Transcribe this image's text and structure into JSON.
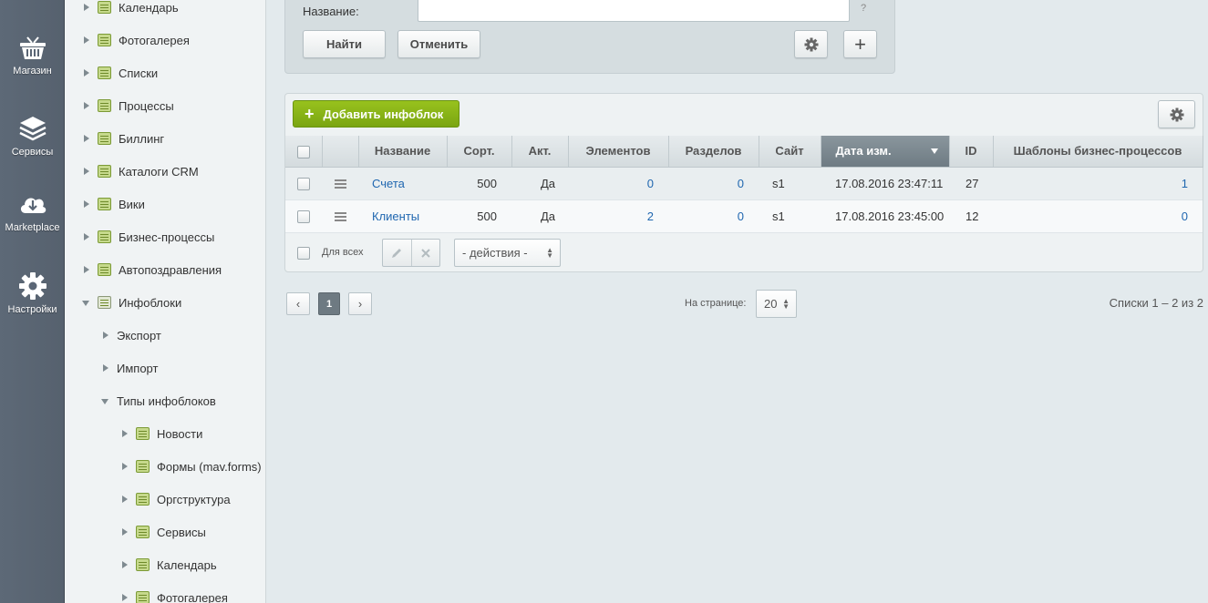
{
  "leftbar": {
    "items": [
      {
        "label": "Магазин",
        "icon": "basket-icon"
      },
      {
        "label": "Сервисы",
        "icon": "layers-icon"
      },
      {
        "label": "Marketplace",
        "icon": "cloud-download-icon"
      },
      {
        "label": "Настройки",
        "icon": "gear-icon"
      }
    ]
  },
  "tree": {
    "items": [
      {
        "label": "Календарь"
      },
      {
        "label": "Фотогалерея"
      },
      {
        "label": "Списки"
      },
      {
        "label": "Процессы"
      },
      {
        "label": "Биллинг"
      },
      {
        "label": "Каталоги CRM"
      },
      {
        "label": "Вики"
      },
      {
        "label": "Бизнес-процессы"
      },
      {
        "label": "Автопоздравления"
      },
      {
        "label": "Инфоблоки"
      },
      {
        "label": "Экспорт"
      },
      {
        "label": "Импорт"
      },
      {
        "label": "Типы инфоблоков"
      },
      {
        "label": "Новости"
      },
      {
        "label": "Формы (mav.forms)"
      },
      {
        "label": "Оргструктура"
      },
      {
        "label": "Сервисы"
      },
      {
        "label": "Календарь"
      },
      {
        "label": "Фотогалерея"
      }
    ]
  },
  "filter": {
    "name_label": "Название:",
    "name_value": "",
    "help": "?",
    "find_label": "Найти",
    "cancel_label": "Отменить",
    "add_symbol": "+"
  },
  "list": {
    "add_label": "Добавить инфоблок",
    "columns": [
      "Название",
      "Сорт.",
      "Акт.",
      "Элементов",
      "Разделов",
      "Сайт",
      "Дата изм.",
      "ID",
      "Шаблоны бизнес-процессов"
    ],
    "sorted_column": "Дата изм.",
    "rows": [
      {
        "name": "Счета",
        "sort": "500",
        "active": "Да",
        "elements": "0",
        "sections": "0",
        "site": "s1",
        "date": "17.08.2016 23:47:11",
        "id": "27",
        "bp": "1"
      },
      {
        "name": "Клиенты",
        "sort": "500",
        "active": "Да",
        "elements": "2",
        "sections": "0",
        "site": "s1",
        "date": "17.08.2016 23:45:00",
        "id": "12",
        "bp": "0"
      }
    ],
    "for_all_label": "Для всех",
    "actions_value": "- действия -"
  },
  "pager": {
    "prev": "‹",
    "current": "1",
    "next": "›",
    "per_page_label": "На странице:",
    "per_page_value": "20",
    "summary": "Списки 1 – 2 из 2"
  },
  "colors": {
    "accent_green": "#86b217",
    "link_blue": "#2067b0",
    "leftbar": "#5a6675"
  }
}
